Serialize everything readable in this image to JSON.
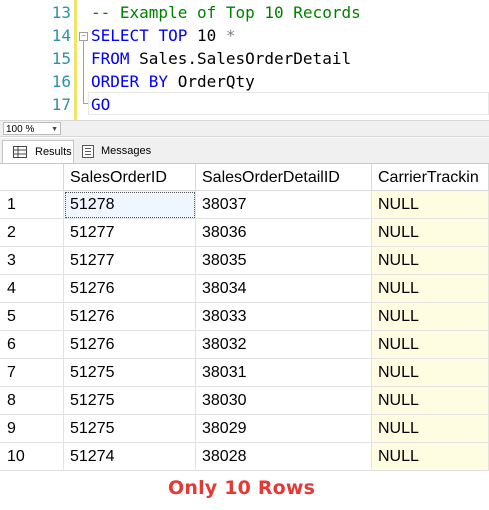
{
  "editor": {
    "lines": [
      {
        "number": "13",
        "tokens": [
          {
            "t": "-- Example of Top 10 Records",
            "c": "cm"
          }
        ]
      },
      {
        "number": "14",
        "tokens": [
          {
            "t": "SELECT",
            "c": "kw"
          },
          {
            "t": " ",
            "c": "tx"
          },
          {
            "t": "TOP",
            "c": "kw"
          },
          {
            "t": " 10 ",
            "c": "tx"
          },
          {
            "t": "*",
            "c": "op"
          }
        ]
      },
      {
        "number": "15",
        "tokens": [
          {
            "t": "FROM",
            "c": "kw"
          },
          {
            "t": " Sales.SalesOrderDetail",
            "c": "tx"
          }
        ]
      },
      {
        "number": "16",
        "tokens": [
          {
            "t": "ORDER BY",
            "c": "kw"
          },
          {
            "t": " OrderQty",
            "c": "tx"
          }
        ]
      },
      {
        "number": "17",
        "tokens": [
          {
            "t": "GO",
            "c": "kw"
          }
        ]
      }
    ]
  },
  "zoom": {
    "value": "100 %"
  },
  "tabs": {
    "results": "Results",
    "messages": "Messages"
  },
  "grid": {
    "columns": [
      "",
      "SalesOrderID",
      "SalesOrderDetailID",
      "CarrierTrackin"
    ],
    "rows": [
      [
        "1",
        "51278",
        "38037",
        "NULL"
      ],
      [
        "2",
        "51277",
        "38036",
        "NULL"
      ],
      [
        "3",
        "51277",
        "38035",
        "NULL"
      ],
      [
        "4",
        "51276",
        "38034",
        "NULL"
      ],
      [
        "5",
        "51276",
        "38033",
        "NULL"
      ],
      [
        "6",
        "51276",
        "38032",
        "NULL"
      ],
      [
        "7",
        "51275",
        "38031",
        "NULL"
      ],
      [
        "8",
        "51275",
        "38030",
        "NULL"
      ],
      [
        "9",
        "51275",
        "38029",
        "NULL"
      ],
      [
        "10",
        "51274",
        "38028",
        "NULL"
      ]
    ]
  },
  "caption": "Only 10 Rows",
  "colors": {
    "keyword": "#0000ff",
    "comment": "#008000",
    "line_number": "#2b91af",
    "null_cell": "#fffde1",
    "caption": "#e53935"
  }
}
